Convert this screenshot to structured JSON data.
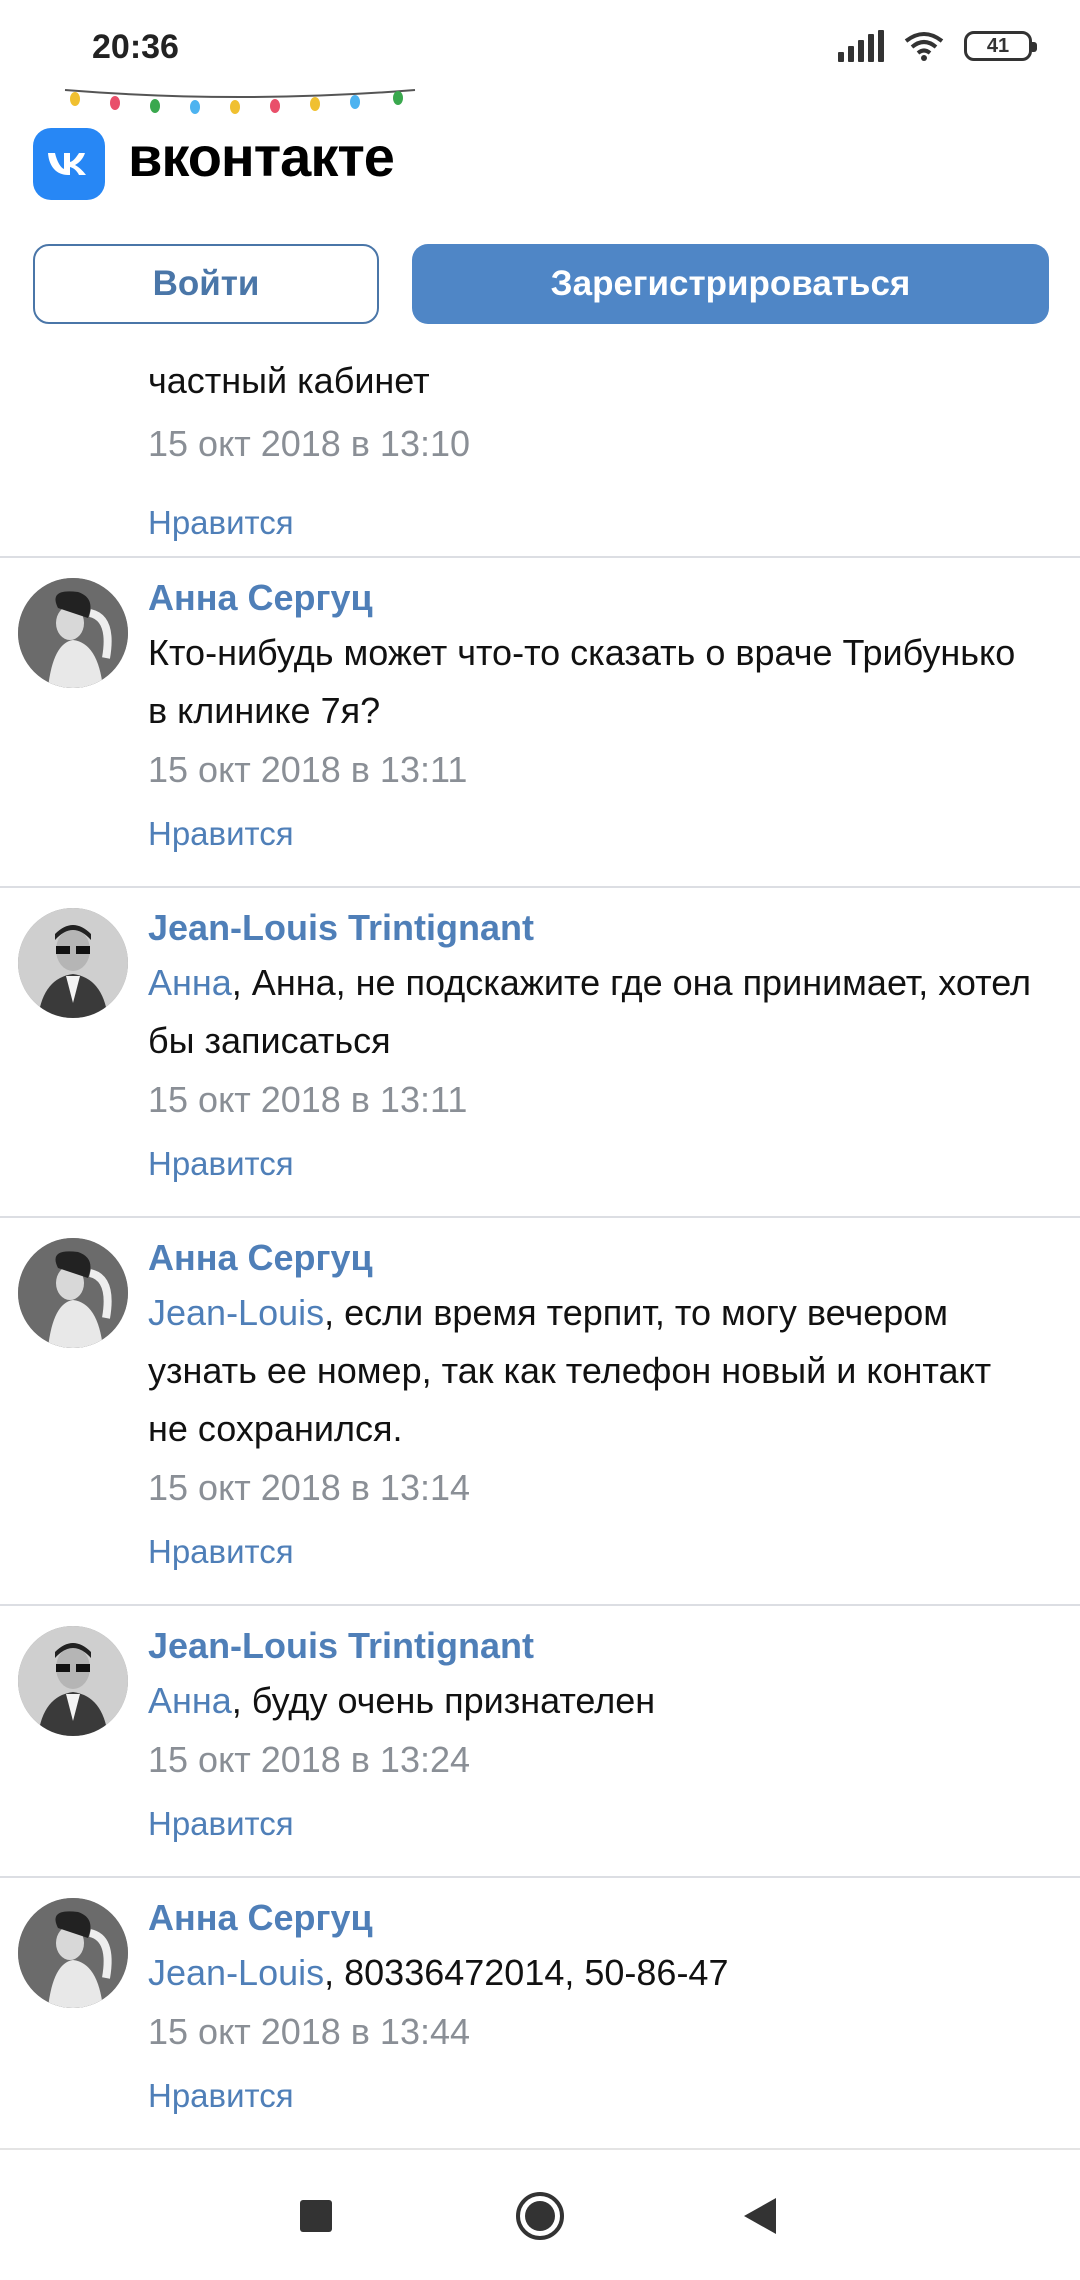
{
  "status_bar": {
    "time": "20:36",
    "battery": "41"
  },
  "header": {
    "brand": "вконтакте",
    "logo_text": "vk"
  },
  "buttons": {
    "login": "Войти",
    "register": "Зарегистрироваться"
  },
  "first_comment_tail": {
    "text": "частный кабинет",
    "date": "15 окт 2018 в 13:10",
    "like": "Нравится"
  },
  "comments": [
    {
      "author": "Анна Сергуц",
      "mention": "",
      "text": "Кто-нибудь может что-то сказать о враче Трибунько в клинике 7я?",
      "date": "15 окт 2018 в 13:11",
      "like": "Нравится",
      "avatar": "woman-avatar"
    },
    {
      "author": "Jean-Louis Trintignant",
      "mention": "Анна",
      "text": ", Анна, не подскажите где она принимает, хотел бы записаться",
      "date": "15 окт 2018 в 13:11",
      "like": "Нравится",
      "avatar": "man-avatar"
    },
    {
      "author": "Анна Сергуц",
      "mention": "Jean-Louis",
      "text": ", если время терпит, то могу вечером узнать ее номер, так как телефон новый и контакт не сохранился.",
      "date": "15 окт 2018 в 13:14",
      "like": "Нравится",
      "avatar": "woman-avatar"
    },
    {
      "author": "Jean-Louis Trintignant",
      "mention": "Анна",
      "text": ", буду очень признателен",
      "date": "15 окт 2018 в 13:24",
      "like": "Нравится",
      "avatar": "man-avatar"
    },
    {
      "author": "Анна Сергуц",
      "mention": "Jean-Louis",
      "text": ", 80336472014, 50-86-47",
      "date": "15 окт 2018 в 13:44",
      "like": "Нравится",
      "avatar": "woman-avatar"
    }
  ],
  "colors": {
    "accent": "#4f7fb8",
    "button": "#4f86c6",
    "logo": "#2787f5",
    "date": "#8a8f96"
  },
  "nav": {
    "icons": [
      "square-icon",
      "home-circle-icon",
      "back-triangle-icon"
    ]
  }
}
